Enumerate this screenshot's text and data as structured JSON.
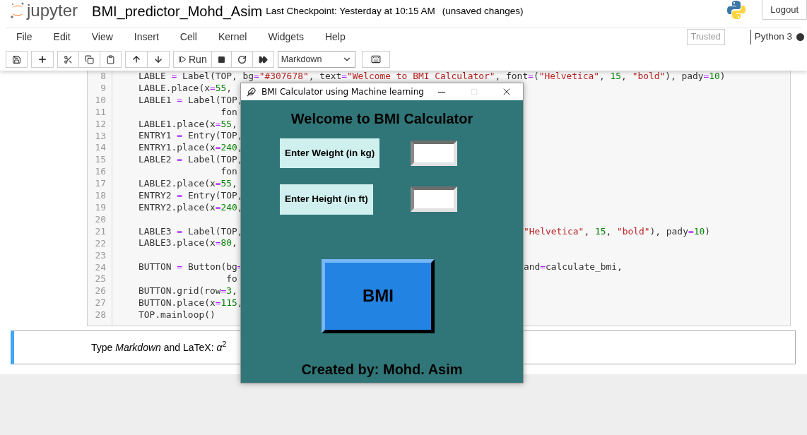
{
  "header": {
    "app_name": "jupyter",
    "notebook_title": "BMI_predictor_Mohd_Asim",
    "checkpoint": "Last Checkpoint: Yesterday at 10:15 AM",
    "unsaved": "(unsaved changes)",
    "logout": "Logout"
  },
  "menu": [
    "File",
    "Edit",
    "View",
    "Insert",
    "Cell",
    "Kernel",
    "Widgets",
    "Help"
  ],
  "trusted": "Trusted",
  "kernel": "Python 3",
  "toolbar": {
    "run_label": "Run",
    "cell_type": "Markdown"
  },
  "code_cell": {
    "lines": [
      {
        "number": "8",
        "left": "LABLE = Label(TOP, bg=\"#307678\", text=\"Welcome to BMI Calculator\", font=(\"Helvetica\", 15, \"bold\"), pady=10)"
      },
      {
        "number": "9",
        "left": "LABLE.place(x=55,"
      },
      {
        "number": "10",
        "left": "LABLE1 = Label(TOP,"
      },
      {
        "number": "11",
        "left": "               fon"
      },
      {
        "number": "12",
        "left": "LABLE1.place(x=55,"
      },
      {
        "number": "13",
        "left": "ENTRY1 = Entry(TOP,"
      },
      {
        "number": "14",
        "left": "ENTRY1.place(x=240,"
      },
      {
        "number": "15",
        "left": "LABLE2 = Label(TOP,"
      },
      {
        "number": "16",
        "left": "               fon"
      },
      {
        "number": "17",
        "left": "LABLE2.place(x=55,"
      },
      {
        "number": "18",
        "left": "ENTRY2 = Entry(TOP,"
      },
      {
        "number": "19",
        "left": "ENTRY2.place(x=240,"
      },
      {
        "number": "20"
      },
      {
        "number": "21",
        "left": "LABLE3 = Label(TOP,",
        "right": "\"Helvetica\", 15, \"bold\"), pady=10)"
      },
      {
        "number": "22",
        "left": "LABLE3.place(x=80,"
      },
      {
        "number": "23"
      },
      {
        "number": "24",
        "left": "BUTTON = Button(bg=",
        "right": "and=calculate_bmi,"
      },
      {
        "number": "25",
        "left": "                fo"
      },
      {
        "number": "26",
        "left": "BUTTON.grid(row=3,"
      },
      {
        "number": "27",
        "left": "BUTTON.place(x=115,"
      },
      {
        "number": "28",
        "left": "TOP.mainloop()"
      }
    ]
  },
  "markdown_cell": {
    "selected": true,
    "text": "Type *Markdown* and LaTeX: *α*$^{2}$"
  },
  "tk_window": {
    "title": "BMI Calculator using Machine learning",
    "heading": "Welcome to BMI Calculator",
    "fields": [
      {
        "label": "Enter Weight (in kg)"
      },
      {
        "label": "Enter Height (in ft)"
      }
    ],
    "button": "BMI",
    "footer": "Created by: Mohd. Asim"
  }
}
